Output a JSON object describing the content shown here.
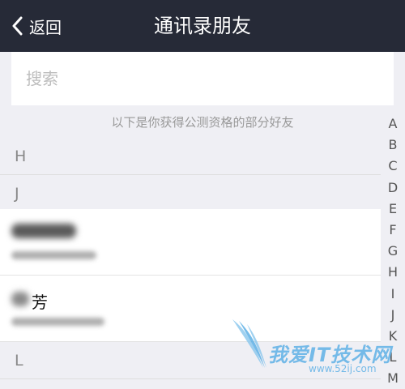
{
  "header": {
    "back_label": "返回",
    "title": "通讯录朋友"
  },
  "search": {
    "placeholder": "搜索"
  },
  "hint_text": "以下是你获得公测资格的部分好友",
  "sections": [
    {
      "letter": "H"
    },
    {
      "letter": "J"
    },
    {
      "letter": "L"
    }
  ],
  "contacts": [
    {
      "name_visible": ""
    },
    {
      "name_visible": "芳"
    }
  ],
  "index_letters": [
    "A",
    "B",
    "C",
    "D",
    "E",
    "F",
    "G",
    "H",
    "I",
    "J",
    "K",
    "L",
    "M"
  ],
  "watermark": {
    "text": "我爱IT技术网",
    "url": "www.52ij.com"
  }
}
